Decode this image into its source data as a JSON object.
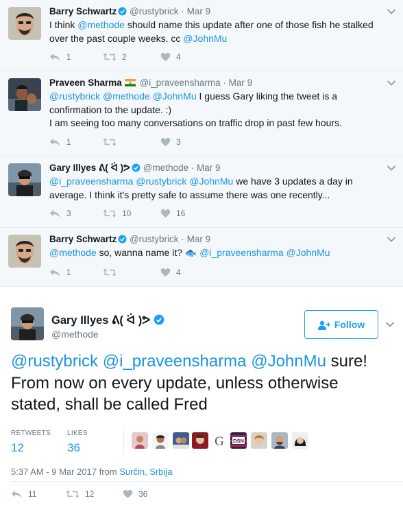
{
  "replies": [
    {
      "name": "Barry Schwartz",
      "handle": "@rustybrick",
      "sep": "·",
      "time": "Mar 9",
      "text": [
        {
          "t": "I think ",
          "m": false
        },
        {
          "t": "@methode",
          "m": true
        },
        {
          "t": " should name this update after one of those fish he stalked over the past couple weeks.  cc ",
          "m": false
        },
        {
          "t": "@JohnMu",
          "m": true
        }
      ],
      "replies": "1",
      "retweets": "2",
      "likes": "4"
    },
    {
      "name": "Praveen Sharma",
      "handle": "@i_praveensharma",
      "sep": "·",
      "time": "Mar 9",
      "text": [
        {
          "t": "@rustybrick",
          "m": true
        },
        {
          "t": " ",
          "m": false
        },
        {
          "t": "@methode",
          "m": true
        },
        {
          "t": " ",
          "m": false
        },
        {
          "t": "@JohnMu",
          "m": true
        },
        {
          "t": " I guess Gary liking the tweet is a confirmation to the update. :)\nI am seeing too many conversations on traffic drop in past few hours.",
          "m": false
        }
      ],
      "replies": "1",
      "retweets": "",
      "likes": "3"
    },
    {
      "name": "Gary Illyes ᕕ( ᐛ )ᕗ",
      "handle": "@methode",
      "sep": "·",
      "time": "Mar 9",
      "text": [
        {
          "t": "@i_praveensharma",
          "m": true
        },
        {
          "t": " ",
          "m": false
        },
        {
          "t": "@rustybrick",
          "m": true
        },
        {
          "t": " ",
          "m": false
        },
        {
          "t": "@JohnMu",
          "m": true
        },
        {
          "t": " we have 3 updates a day in average. I think it's pretty safe to assume there was one recently...",
          "m": false
        }
      ],
      "replies": "3",
      "retweets": "10",
      "likes": "16"
    },
    {
      "name": "Barry Schwartz",
      "handle": "@rustybrick",
      "sep": "·",
      "time": "Mar 9",
      "text": [
        {
          "t": "@methode",
          "m": true
        },
        {
          "t": " so, wanna name it? 🐟 ",
          "m": false
        },
        {
          "t": "@i_praveensharma",
          "m": true
        },
        {
          "t": " ",
          "m": false
        },
        {
          "t": "@JohnMu",
          "m": true
        }
      ],
      "replies": "1",
      "retweets": "",
      "likes": "4"
    }
  ],
  "main": {
    "name": "Gary Illyes ᕕ( ᐛ )ᕗ",
    "handle": "@methode",
    "follow_label": "Follow",
    "text": [
      {
        "t": "@rustybrick",
        "m": true
      },
      {
        "t": " ",
        "m": false
      },
      {
        "t": "@i_praveensharma",
        "m": true
      },
      {
        "t": " ",
        "m": false
      },
      {
        "t": "@JohnMu",
        "m": true
      },
      {
        "t": " sure! From now on every update, unless otherwise stated, shall be called Fred",
        "m": false
      }
    ],
    "retweets_label": "RETWEETS",
    "retweets": "12",
    "likes_label": "LIKES",
    "likes": "36",
    "timestamp": "5:37 AM - 9 Mar 2017 from ",
    "location": "Surčin, Srbija",
    "replies_count": "11",
    "retweets_count": "12",
    "likes_count": "36"
  },
  "colors": {
    "accent": "#1da1f2",
    "link": "#1b95e0",
    "muted": "#657786",
    "reply_bg": "#f5f8fa"
  },
  "icons": [
    "reply-icon",
    "retweet-icon",
    "like-icon",
    "verified-icon",
    "india-flag-icon",
    "fish-emoji",
    "chevron-down-icon",
    "follow-person-icon"
  ]
}
